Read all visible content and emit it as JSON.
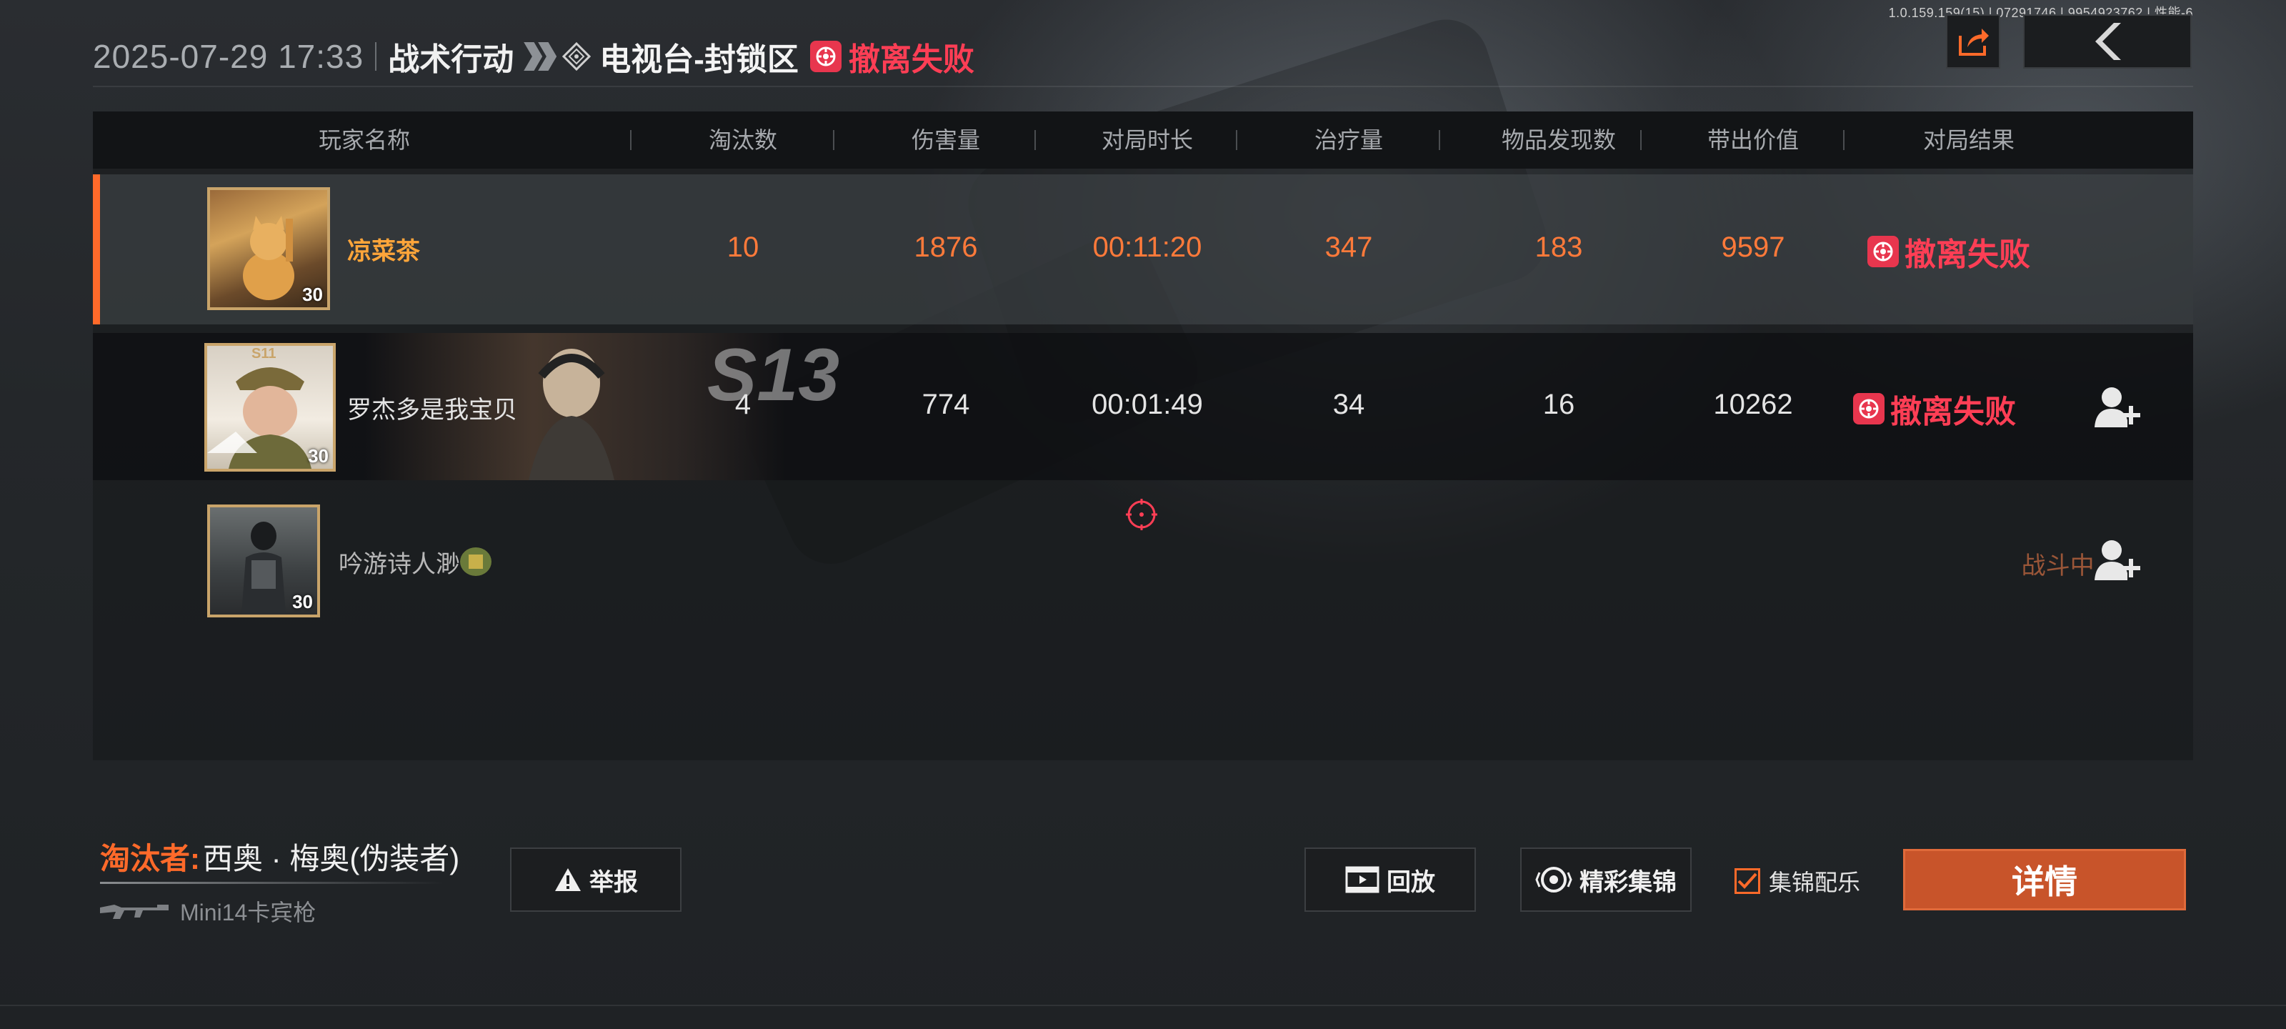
{
  "debug_info": "1.0.159.159(15) | 07291746 | 9954923762 | 性能-6",
  "header": {
    "datetime": "2025-07-29 17:33",
    "mode": "战术行动",
    "map": "电视台-封锁区",
    "result": "撤离失败"
  },
  "table": {
    "columns": [
      "玩家名称",
      "淘汰数",
      "伤害量",
      "对局时长",
      "治疗量",
      "物品发现数",
      "带出价值",
      "对局结果"
    ],
    "rows": [
      {
        "name": "凉菜茶",
        "level": "30",
        "kills": "10",
        "damage": "1876",
        "duration": "00:11:20",
        "healing": "347",
        "items": "183",
        "value": "9597",
        "result": "撤离失败"
      },
      {
        "name": "罗杰多是我宝贝",
        "level": "30",
        "badge": "S11",
        "banner": "S13",
        "kills": "4",
        "damage": "774",
        "duration": "00:01:49",
        "healing": "34",
        "items": "16",
        "value": "10262",
        "result": "撤离失败"
      },
      {
        "name": "吟游诗人渺",
        "level": "30",
        "result": "战斗中..."
      }
    ]
  },
  "footer": {
    "eliminator_label": "淘汰者:",
    "eliminator_name": "西奥 · 梅奥(伪装者)",
    "weapon": "Mini14卡宾枪",
    "report": "举报",
    "replay": "回放",
    "highlights": "精彩集锦",
    "bgm_label": "集锦配乐",
    "bgm_checked": true,
    "details": "详情"
  },
  "colors": {
    "accent": "#ff6a2a",
    "fail": "#ff3e55",
    "self_name": "#ffa53a"
  }
}
